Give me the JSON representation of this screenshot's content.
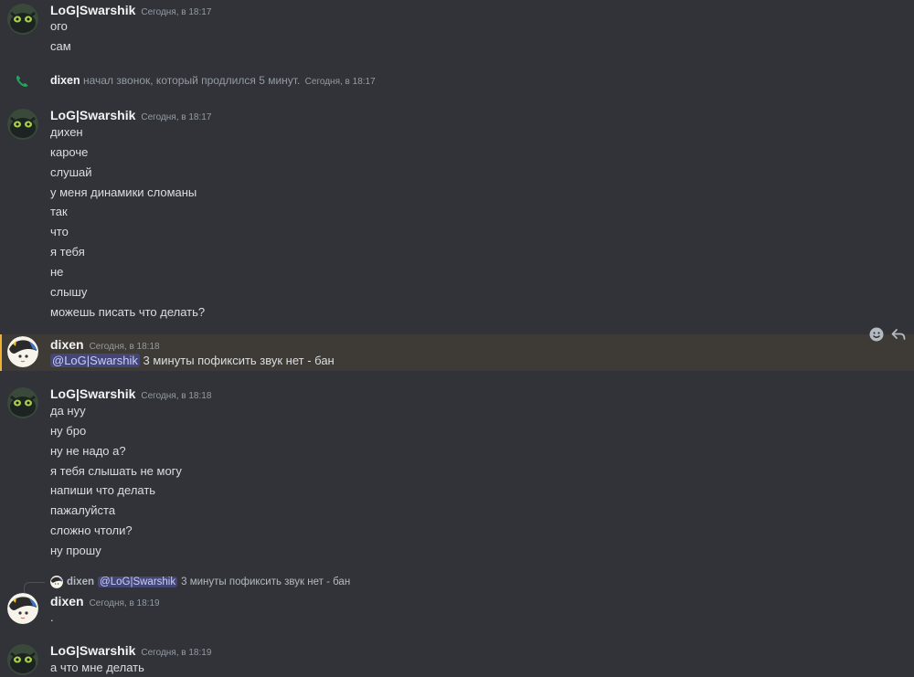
{
  "messages": {
    "g1": {
      "username": "LoG|Swarshik",
      "timestamp": "Сегодня, в 18:17",
      "lines": [
        "ого",
        "сам"
      ]
    },
    "call": {
      "username": "dixen",
      "text": "начал звонок, который продлился 5 минут.",
      "timestamp": "Сегодня, в 18:17"
    },
    "g2": {
      "username": "LoG|Swarshik",
      "timestamp": "Сегодня, в 18:17",
      "lines": [
        "дихен",
        "кароче",
        "слушай",
        "у меня динамики сломаны",
        "так",
        "что",
        "я тебя",
        "не",
        "слышу",
        "можешь писать что делать?"
      ]
    },
    "g3": {
      "username": "dixen",
      "timestamp": "Сегодня, в 18:18",
      "mention": "@LoG|Swarshik",
      "text": "3 минуты пофиксить звук нет - бан"
    },
    "g4": {
      "username": "LoG|Swarshik",
      "timestamp": "Сегодня, в 18:18",
      "lines": [
        "да нуу",
        "ну бро",
        "ну не надо а?",
        "я тебя слышать не могу",
        "напиши что делать",
        "пажалуйста",
        "сложно чтоли?",
        "ну прошу"
      ]
    },
    "reply": {
      "username": "dixen",
      "mention": "@LoG|Swarshik",
      "text": "3 минуты пофиксить звук нет - бан"
    },
    "g5": {
      "username": "dixen",
      "timestamp": "Сегодня, в 18:19",
      "lines": [
        "."
      ]
    },
    "g6": {
      "username": "LoG|Swarshik",
      "timestamp": "Сегодня, в 18:19",
      "lines": [
        "а что мне делать"
      ]
    }
  },
  "icons": {
    "call": "phone-icon",
    "toolbar_react": "add-reaction-icon",
    "toolbar_reply": "reply-icon"
  },
  "colors": {
    "background": "#313338",
    "highlight": "#3e3b36",
    "mention_bg": "#444677",
    "call_green": "#23a559"
  }
}
